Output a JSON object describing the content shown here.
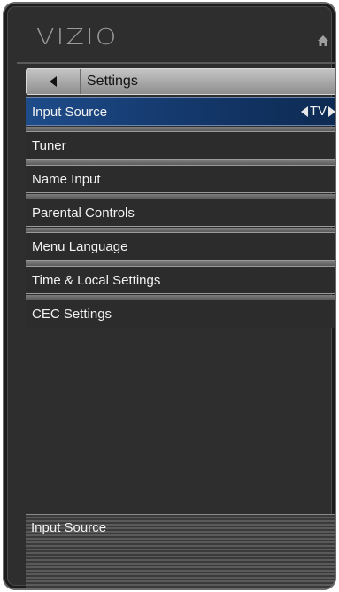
{
  "brand": {
    "logo": "VIZIO"
  },
  "header": {
    "title": "Settings"
  },
  "menu": {
    "items": [
      {
        "label": "Input Source",
        "value": "TV"
      },
      {
        "label": "Tuner"
      },
      {
        "label": "Name Input"
      },
      {
        "label": "Parental Controls"
      },
      {
        "label": "Menu Language"
      },
      {
        "label": "Time & Local Settings"
      },
      {
        "label": "CEC Settings"
      }
    ],
    "selected_index": 0
  },
  "footer": {
    "description": "Input Source"
  },
  "colors": {
    "selected": "#1e4c8a",
    "panel": "#2e2e2e"
  },
  "icons": {
    "home": "home-icon",
    "back": "back-arrow-icon",
    "left": "arrow-left-icon",
    "right": "arrow-right-icon"
  }
}
